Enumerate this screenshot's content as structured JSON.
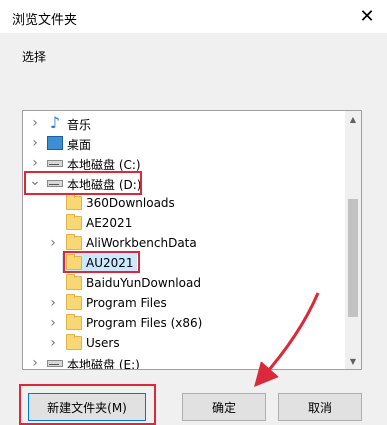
{
  "window": {
    "title": "浏览文件夹",
    "close_glyph": "✕"
  },
  "prompt": "选择",
  "tree": {
    "items": [
      {
        "label": "音乐",
        "icon": "music-icon",
        "level": 1,
        "chevron": "right"
      },
      {
        "label": "桌面",
        "icon": "desktop-icon",
        "level": 1,
        "chevron": "right"
      },
      {
        "label": "本地磁盘 (C:)",
        "icon": "drive-icon",
        "level": 1,
        "chevron": "right"
      },
      {
        "label": "本地磁盘 (D:)",
        "icon": "drive-icon",
        "level": 1,
        "chevron": "down"
      },
      {
        "label": "360Downloads",
        "icon": "folder-icon",
        "level": 2,
        "chevron": "none"
      },
      {
        "label": "AE2021",
        "icon": "folder-icon",
        "level": 2,
        "chevron": "none"
      },
      {
        "label": "AliWorkbenchData",
        "icon": "folder-icon",
        "level": 2,
        "chevron": "right"
      },
      {
        "label": "AU2021",
        "icon": "folder-icon",
        "level": 2,
        "chevron": "none",
        "selected": true
      },
      {
        "label": "BaiduYunDownload",
        "icon": "folder-icon",
        "level": 2,
        "chevron": "none"
      },
      {
        "label": "Program Files",
        "icon": "folder-icon",
        "level": 2,
        "chevron": "right"
      },
      {
        "label": "Program Files (x86)",
        "icon": "folder-icon",
        "level": 2,
        "chevron": "right"
      },
      {
        "label": "Users",
        "icon": "folder-icon",
        "level": 2,
        "chevron": "right"
      },
      {
        "label": "本地磁盘 (E:)",
        "icon": "drive-icon",
        "level": 1,
        "chevron": "right"
      }
    ]
  },
  "buttons": {
    "new_folder": "新建文件夹(M)",
    "ok": "确定",
    "cancel": "取消"
  },
  "colors": {
    "highlight": "#d9293a",
    "accent": "#0078d7"
  }
}
